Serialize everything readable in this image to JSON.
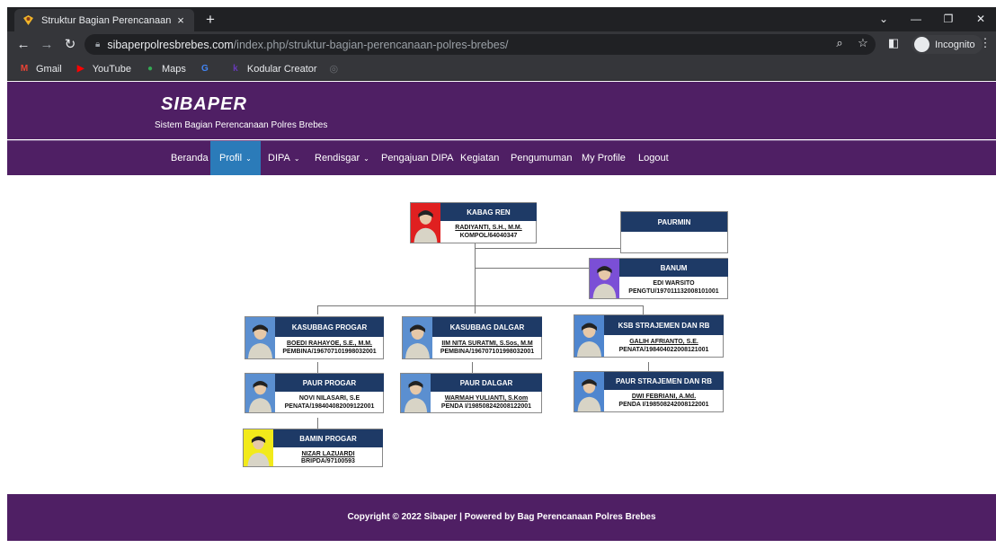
{
  "browser": {
    "tab_title": "Struktur Bagian Perencanaan Pol",
    "url_host": "sibaperpolresbrebes.com",
    "url_path": "/index.php/struktur-bagian-perencanaan-polres-brebes/",
    "incognito_label": "Incognito",
    "bookmarks": [
      {
        "label": "Gmail",
        "icon": "gmail-icon",
        "color": "#ea4335"
      },
      {
        "label": "YouTube",
        "icon": "youtube-icon",
        "color": "#ff0000"
      },
      {
        "label": "Maps",
        "icon": "maps-icon",
        "color": "#34a853"
      },
      {
        "label": "",
        "icon": "google-icon",
        "color": "#4285f4"
      },
      {
        "label": "Kodular Creator",
        "icon": "kodular-icon",
        "color": "#673ab7"
      }
    ]
  },
  "site": {
    "brand": "SIBAPER",
    "tagline": "Sistem Bagian Perencanaan Polres Brebes",
    "nav": [
      {
        "label": "Beranda",
        "dropdown": false,
        "active": false
      },
      {
        "label": "Profil",
        "dropdown": true,
        "active": true
      },
      {
        "label": "DIPA",
        "dropdown": true,
        "active": false
      },
      {
        "label": "Rendisgar",
        "dropdown": true,
        "active": false
      },
      {
        "label": "Pengajuan DIPA",
        "dropdown": false,
        "active": false
      },
      {
        "label": "Kegiatan",
        "dropdown": false,
        "active": false
      },
      {
        "label": "Pengumuman",
        "dropdown": false,
        "active": false
      },
      {
        "label": "My Profile",
        "dropdown": false,
        "active": false
      },
      {
        "label": "Logout",
        "dropdown": false,
        "active": false
      }
    ],
    "footer": "Copyright © 2022 Sibaper | Powered by Bag Perencanaan Polres Brebes"
  },
  "org": {
    "kabag": {
      "title": "KABAG REN",
      "name": "RADIYANTI, S.H., M.M.",
      "nip": "KOMPOL/64040347",
      "photo_bg": "#e02020"
    },
    "paurmin": {
      "title": "PAURMIN",
      "name": "",
      "nip": ""
    },
    "banum": {
      "title": "BANUM",
      "name": "EDI WARSITO",
      "nip": "PENGTU/197011132008101001",
      "photo_bg": "#7b4fd6"
    },
    "kasubbag_progar": {
      "title": "KASUBBAG PROGAR",
      "name": "BOEDI RAHAYOE, S.E., M.M.",
      "nip": "PEMBINA/196707101998032001",
      "photo_bg": "#5b8fd0"
    },
    "kasubbag_dalgar": {
      "title": "KASUBBAG DALGAR",
      "name": "IIM NITA SURATMI, S.Sos, M.M",
      "nip": "PEMBINA/196707101998032001",
      "photo_bg": "#5b8fd0"
    },
    "ksb_strajemen": {
      "title": "KSB STRAJEMEN DAN RB",
      "name": "GALIH AFRIANTO, S.E.",
      "nip": "PENATA/198404022008121001",
      "photo_bg": "#4f86cf"
    },
    "paur_progar": {
      "title": "PAUR PROGAR",
      "name": "NOVI NILASARI, S.E",
      "nip": "PENATA/198404082009122001",
      "photo_bg": "#5b8fd0"
    },
    "paur_dalgar": {
      "title": "PAUR DALGAR",
      "name": "WARMAH YULIANTI, S.Kom",
      "nip": "PENDA I/198508242008122001",
      "photo_bg": "#5b8fd0"
    },
    "paur_strajemen": {
      "title": "PAUR STRAJEMEN DAN RB",
      "name": "DWI FEBRIANI, A.Md.",
      "nip": "PENDA I/198508242008122001",
      "photo_bg": "#4f86cf"
    },
    "bamin_progar": {
      "title": "BAMIN PROGAR",
      "name": "NIZAR LAZUARDI",
      "nip": "BRIPDA/97100593",
      "photo_bg": "#f2ea1a"
    }
  }
}
